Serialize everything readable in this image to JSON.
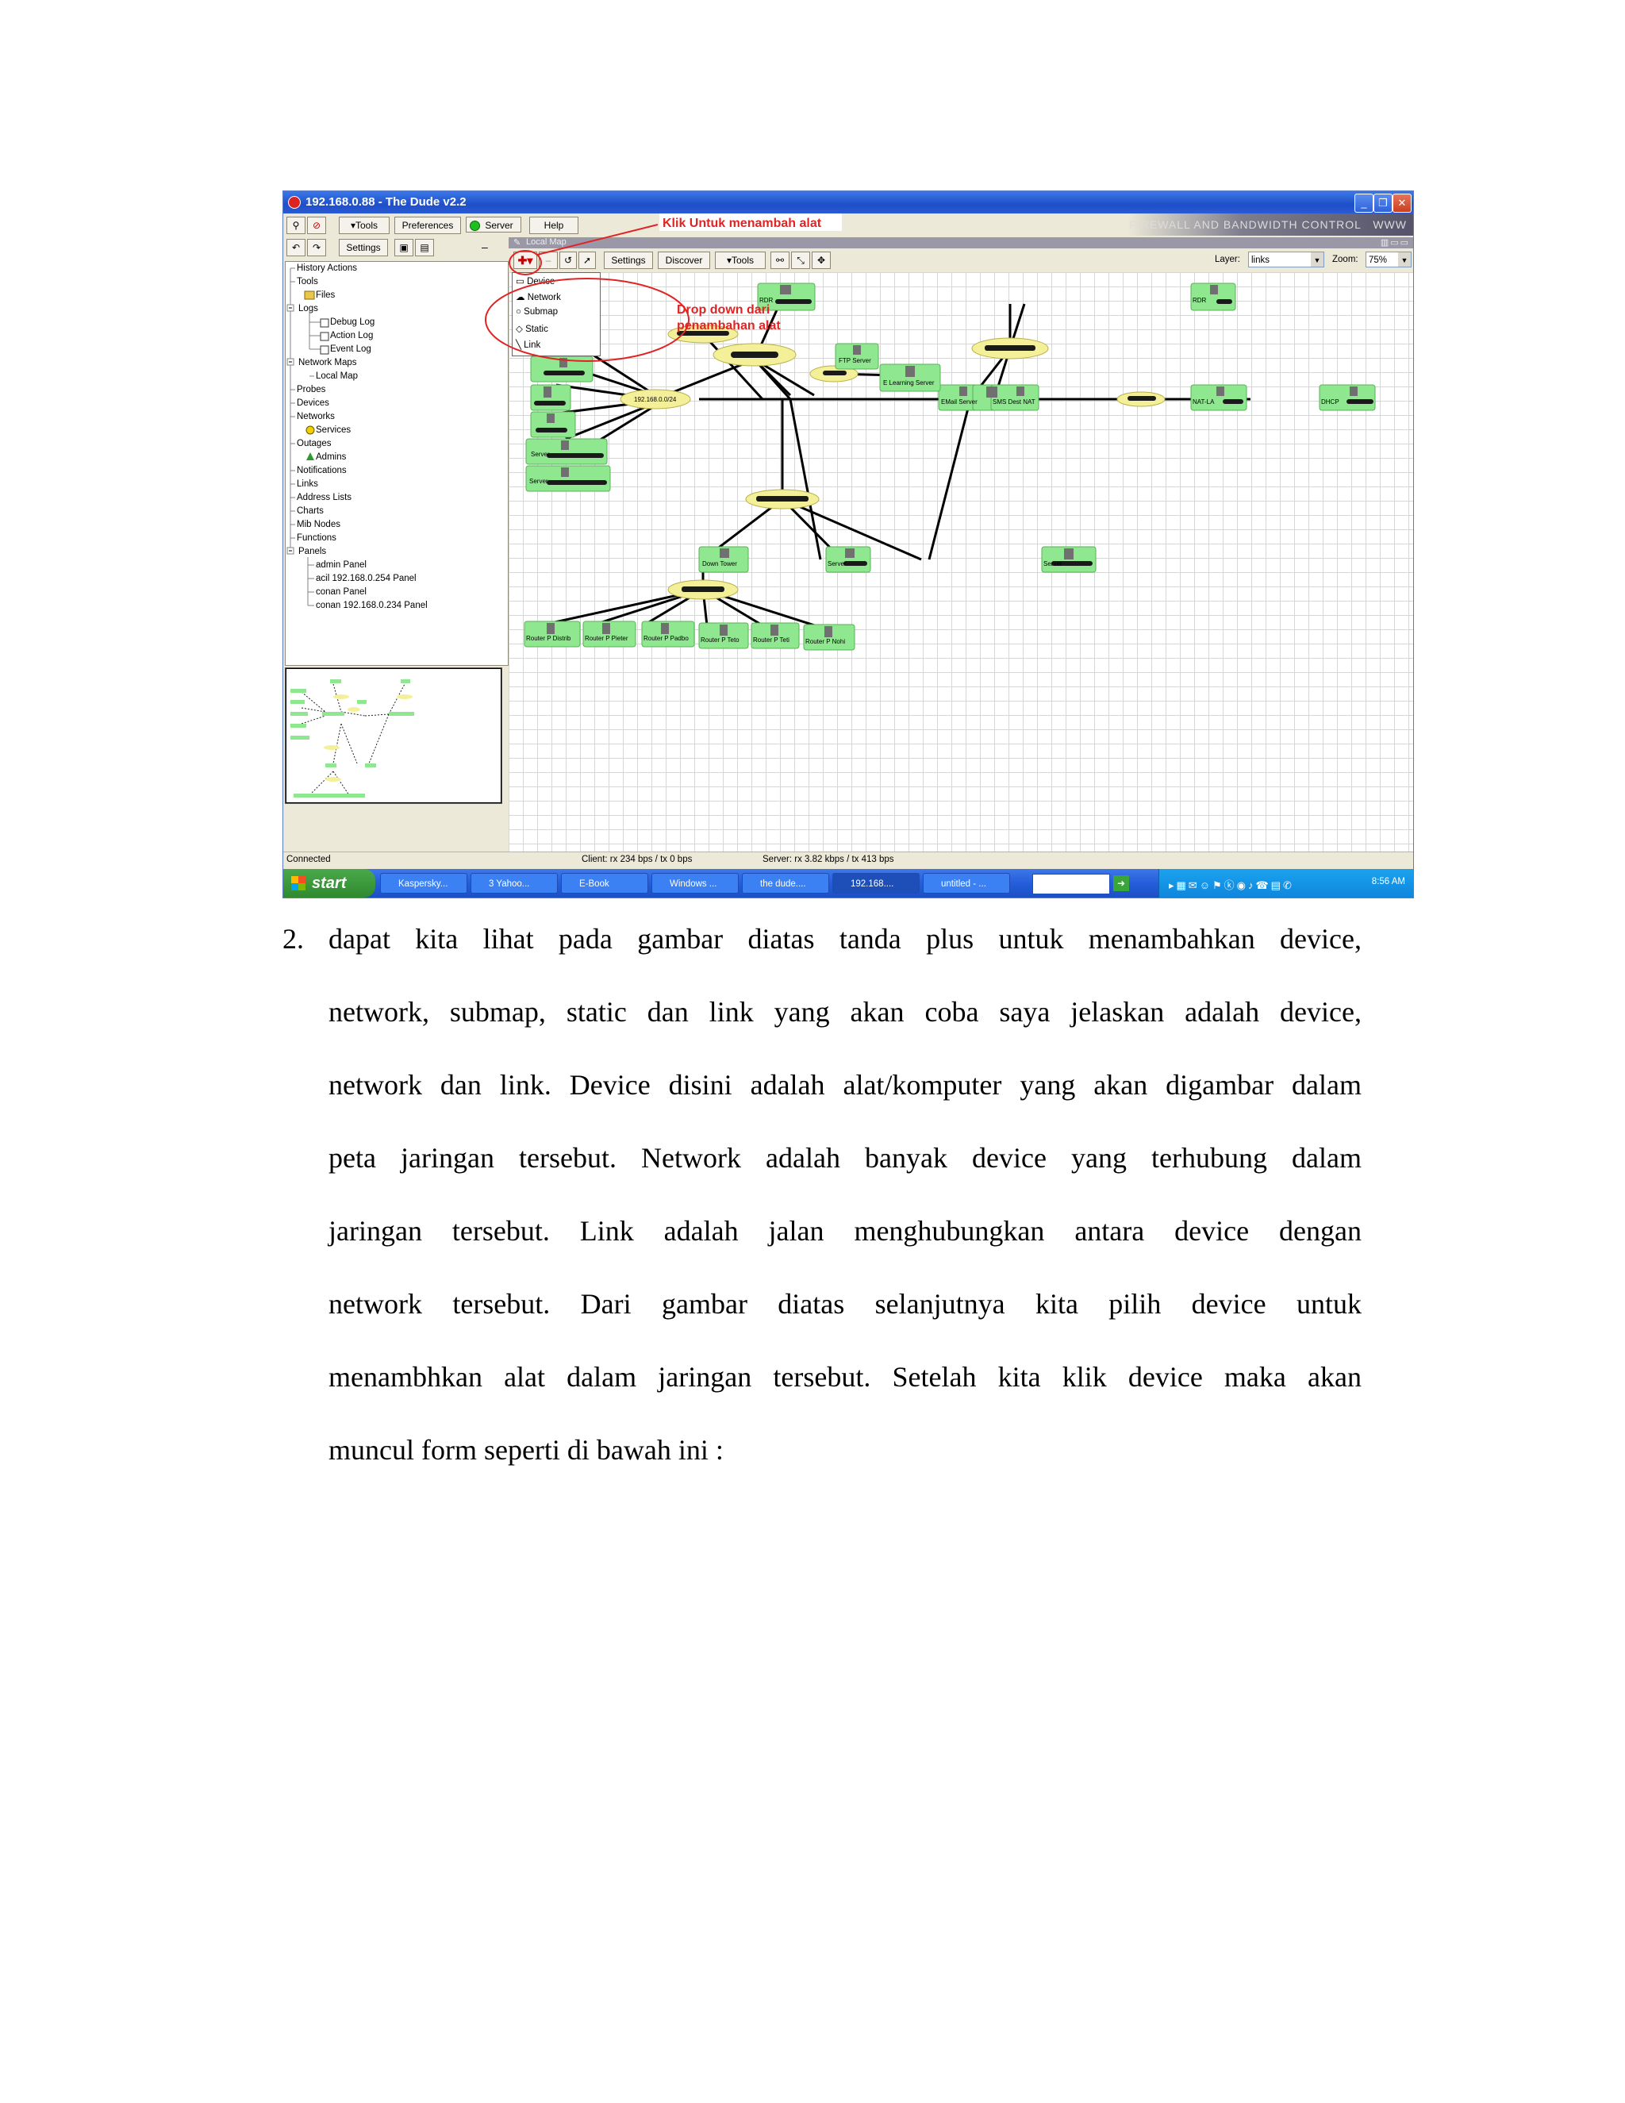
{
  "app": {
    "window_title": "192.168.0.88 - The Dude v2.2",
    "brand_text": "FIREWALL AND BANDWIDTH CONTROL",
    "brand_suffix": "WWW",
    "menu": {
      "tools": "▾Tools",
      "preferences": "Preferences",
      "server": "Server",
      "help": "Help"
    },
    "left_toolbar": {
      "settings": "Settings"
    },
    "map_tab_label": "Local Map",
    "map_toolbar": {
      "settings": "Settings",
      "discover": "Discover",
      "tools": "▾Tools",
      "layer_label": "Layer:",
      "layer_value": "links",
      "zoom_label": "Zoom:",
      "zoom_value": "75%"
    },
    "dropdown": {
      "items": [
        "Device",
        "Network",
        "Submap",
        "Static",
        "Link"
      ]
    },
    "annotations": {
      "add": "Klik Untuk menambah alat",
      "dropdown_line1": "Drop down dari",
      "dropdown_line2": "penambahan alat"
    },
    "tree": [
      "History Actions",
      "Tools",
      "Files",
      "Logs",
      "Debug Log",
      "Action Log",
      "Event Log",
      "Network Maps",
      "Local Map",
      "Probes",
      "Devices",
      "Networks",
      "Services",
      "Outages",
      "Admins",
      "Notifications",
      "Links",
      "Address Lists",
      "Charts",
      "Mib Nodes",
      "Functions",
      "Panels",
      "admin Panel",
      "acil 192.168.0.254 Panel",
      "conan Panel",
      "conan 192.168.0.234 Panel"
    ],
    "map_labels": {
      "server": "Server",
      "network": "192.168.0.0/24",
      "email_server": "EMail Server",
      "sms_dest_nat": "SMS Dest NAT",
      "ftp_server": "FTP Server",
      "elearning": "E Learning Server",
      "nat": "NAT-LA",
      "dhcp": "DHCP",
      "down_tower": "Down Tower",
      "rdr": "RDR",
      "router_1": "Router P Distrib",
      "router_2": "Router P Pieter",
      "router_3": "Router P Padbo",
      "router_4": "Router P Teto",
      "router_5": "Router P Teti",
      "router_6": "Router P Nohi"
    },
    "status": {
      "connected": "Connected",
      "client": "Client: rx 234 bps / tx 0 bps",
      "server": "Server: rx 3.82 kbps / tx 413 bps"
    },
    "taskbar": {
      "start": "start",
      "items": [
        "Kaspersky...",
        "3 Yahoo...",
        "E-Book",
        "Windows ...",
        "the dude....",
        "192.168....",
        "untitled - ..."
      ],
      "clock": "8:56 AM"
    }
  },
  "text": {
    "number": "2.",
    "lines": [
      "dapat kita lihat pada gambar diatas tanda plus untuk menambahkan device,",
      "network, submap, static dan link yang akan coba saya jelaskan adalah device,",
      "network dan link. Device disini adalah alat/komputer yang akan digambar dalam",
      "peta jaringan tersebut. Network adalah banyak device yang terhubung dalam",
      "jaringan tersebut. Link adalah jalan menghubungkan antara device dengan",
      "network tersebut. Dari gambar diatas selanjutnya kita pilih device untuk",
      "menambhkan alat dalam jaringan tersebut. Setelah kita klik device maka akan",
      "muncul form seperti di bawah ini :"
    ]
  }
}
